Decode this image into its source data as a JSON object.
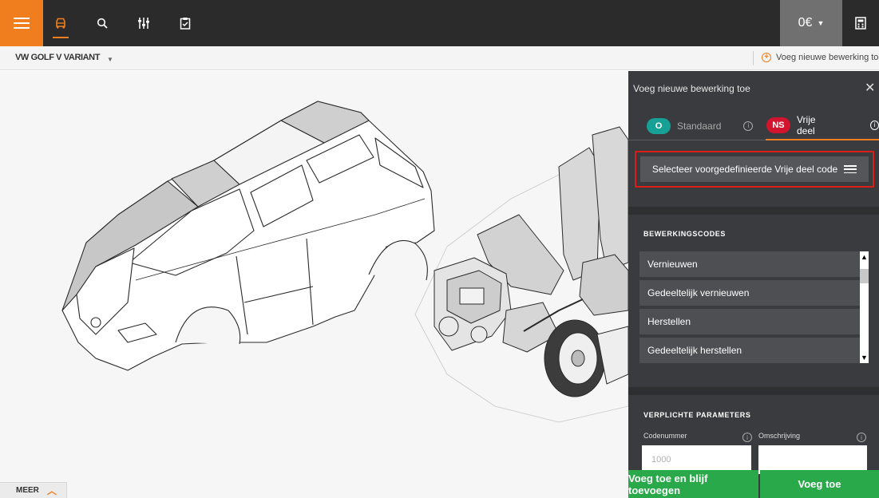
{
  "topbar": {
    "icons": [
      "menu-icon",
      "car-icon",
      "search-icon",
      "sliders-icon",
      "clipboard-icon",
      "calculator-icon"
    ],
    "price": "0€",
    "accent": "#f07d1e"
  },
  "subbar": {
    "model": "VW GOLF V VARIANT",
    "add_operation": "Voeg nieuwe bewerking toe"
  },
  "canvas": {
    "meer_label": "MEER"
  },
  "panel": {
    "title": "Voeg nieuwe bewerking toe",
    "tabs": [
      {
        "badge": "O",
        "label": "Standaard",
        "badge_color": "#17a095"
      },
      {
        "badge": "NS",
        "label": "Vrije deel",
        "badge_color": "#d3142f"
      }
    ],
    "select_button": "Selecteer voorgedefinieerde Vrije deel code",
    "codes_title": "BEWERKINGSCODES",
    "codes": [
      "Vernieuwen",
      "Gedeeltelijk vernieuwen",
      "Herstellen",
      "Gedeeltelijk herstellen"
    ],
    "params_title": "VERPLICHTE PARAMETERS",
    "code_label": "Codenummer",
    "code_placeholder": "1000",
    "desc_label": "Omschrijving",
    "btn_add_continue": "Voeg toe en blijf toevoegen",
    "btn_add": "Voeg toe",
    "highlight_color": "#d91e18",
    "green": "#2aa94b"
  }
}
